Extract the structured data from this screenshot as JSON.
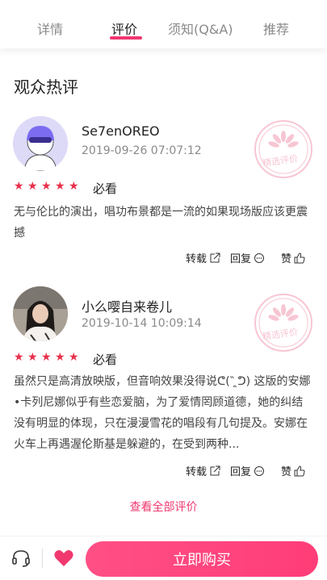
{
  "tabs": [
    {
      "label": "详情"
    },
    {
      "label": "评价"
    },
    {
      "label": "须知(Q&A)"
    },
    {
      "label": "推荐"
    }
  ],
  "active_tab": "评价",
  "section_title": "观众热评",
  "reviews": [
    {
      "username": "Se7enOREO",
      "timestamp": "2019-09-26 07:07:12",
      "stamp": "精选评价",
      "rating": 5,
      "verdict": "必看",
      "content": "无与伦比的演出，唱功布景都是一流的如果现场版应该更震撼",
      "actions": {
        "repost": "转载",
        "reply": "回复",
        "like": "赞"
      }
    },
    {
      "username": "小么嘤自来卷儿",
      "timestamp": "2019-10-14 10:09:14",
      "stamp": "精选评价",
      "rating": 5,
      "verdict": "必看",
      "content": "虽然只是高清放映版，但音响效果没得说ᕦ(‶  ̯ᕤ) 这版的安娜•卡列尼娜似乎有些恋爱脑，为了爱情罔顾道德，她的纠结没有明显的体现，只在漫漫雪花的唱段有几句提及。安娜在火车上再遇渥伦斯基是躲避的，在受到两种...",
      "actions": {
        "repost": "转载",
        "reply": "回复",
        "like": "赞"
      }
    }
  ],
  "view_all": "查看全部评价",
  "bottom_bar": {
    "buy_label": "立即购买"
  },
  "colors": {
    "accent": "#f0386f",
    "star": "#e8304b",
    "stamp": "#f7c6d3"
  }
}
